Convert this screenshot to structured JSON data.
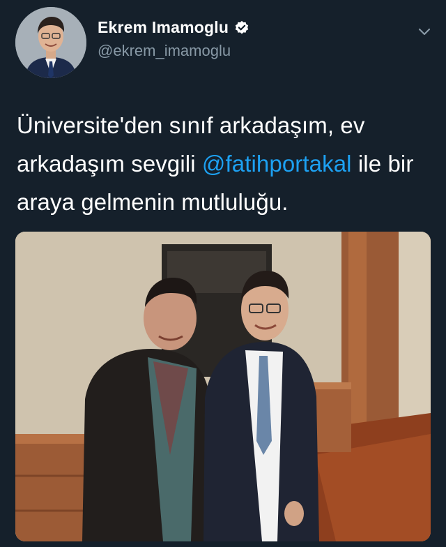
{
  "tweet": {
    "display_name": "Ekrem Imamoglu",
    "handle": "@ekrem_imamoglu",
    "verified_icon": "verified-badge-icon",
    "more_icon": "chevron-down-icon",
    "text_part1": "Üniversite'den sınıf arkadaşım, ev arkadaşım sevgili ",
    "mention": "@fatihportakal",
    "text_part2": " ile bir araya gelmenin mutluluğu.",
    "mention_color": "#1da1f2",
    "background_color": "#15202b"
  }
}
